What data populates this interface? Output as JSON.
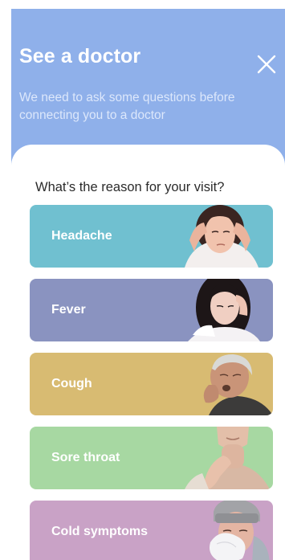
{
  "header": {
    "title": "See a doctor",
    "subtitle": "We need to ask some questions before connecting you to a doctor",
    "close_icon": "close-icon",
    "background_color": "#8fb0ea"
  },
  "main": {
    "question": "What’s the reason for your visit?",
    "reasons": [
      {
        "label": "Headache",
        "color": "#70c0d0"
      },
      {
        "label": "Fever",
        "color": "#8a93c0"
      },
      {
        "label": "Cough",
        "color": "#d8bb72"
      },
      {
        "label": "Sore throat",
        "color": "#a7d8a2"
      },
      {
        "label": "Cold symptoms",
        "color": "#c9a2c6"
      }
    ]
  }
}
